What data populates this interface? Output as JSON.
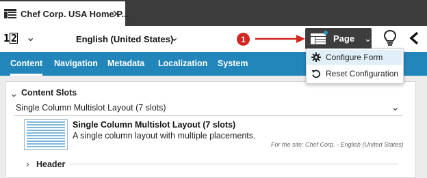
{
  "tab": {
    "title": "Chef Corp. USA Home P...",
    "close_glyph": "✕",
    "icon": "layout-icon"
  },
  "toolbar": {
    "counter_a": "1",
    "counter_b": "2",
    "counter_caret": "⌄",
    "language": "English (United States)",
    "language_caret": "⌄",
    "callout_number": "1",
    "page_button_label": "Page",
    "page_button_caret": "⌄",
    "accent": "#d32620",
    "dark": "#3d3d3d"
  },
  "nav": {
    "color": "#2386ba",
    "items": [
      {
        "label": "Content",
        "active": true
      },
      {
        "label": "Navigation"
      },
      {
        "label": "Metadata"
      },
      {
        "label": "Localization"
      },
      {
        "label": "System"
      }
    ]
  },
  "dropdown": {
    "items": [
      {
        "label": "Configure Form",
        "icon": "gear-icon",
        "highlighted": true
      },
      {
        "label": "Reset Configuration",
        "icon": "reset-icon"
      }
    ]
  },
  "content": {
    "section_title": "Content Slots",
    "section_chevron": "⌄",
    "layout_select_value": "Single Column Multislot Layout (7 slots)",
    "layout_select_caret": "⌄",
    "selected_layout_title": "Single Column Multislot Layout (7 slots)",
    "selected_layout_desc": "A single column layout with multiple placements.",
    "site_note": "For the site: Chef Corp. - English (United States)",
    "header_chevron": "›",
    "header_label": "Header"
  }
}
